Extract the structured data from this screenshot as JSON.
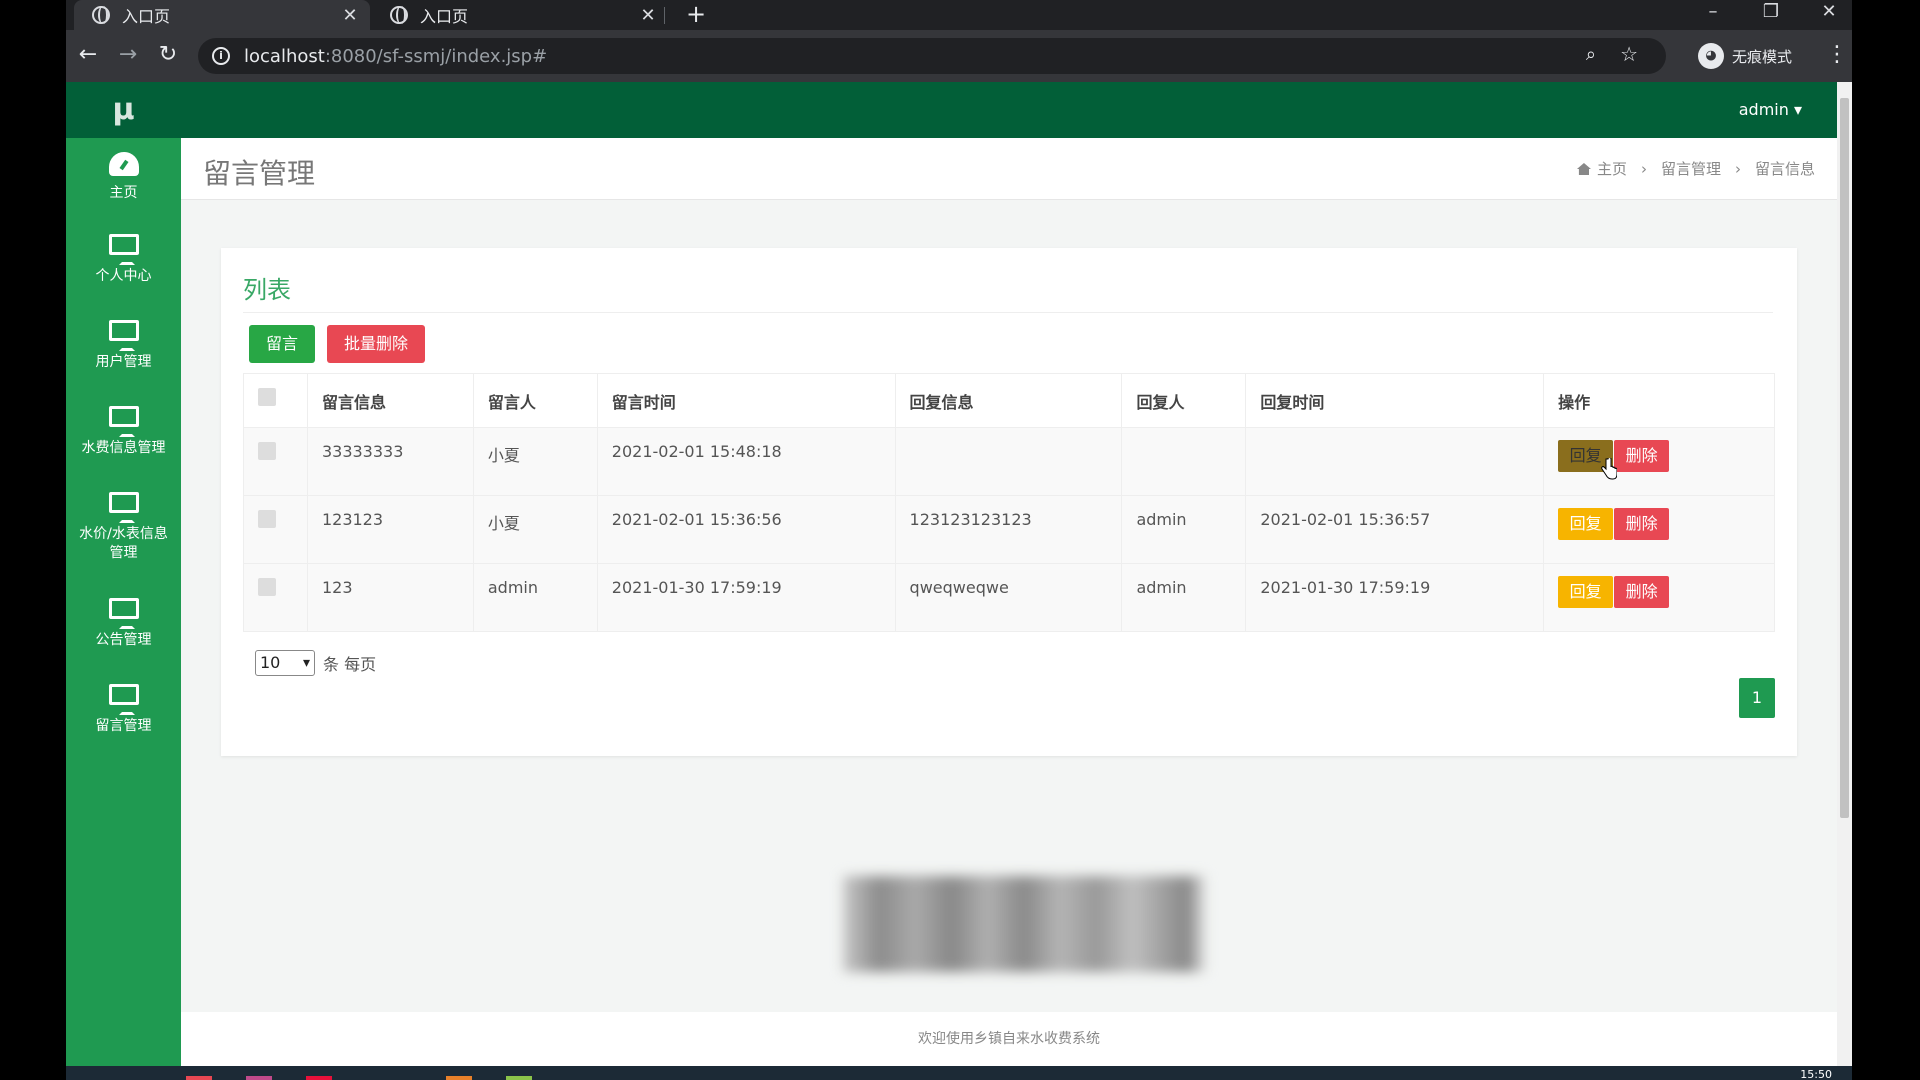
{
  "browser": {
    "tabs": [
      {
        "title": "入口页",
        "active": true
      },
      {
        "title": "入口页",
        "active": false
      }
    ],
    "url_host": "localhost",
    "url_path": ":8080/sf-ssmj/index.jsp#",
    "incognito_label": "无痕模式"
  },
  "app": {
    "logo": "μ",
    "user": "admin ▾",
    "sidebar": [
      {
        "label": "主页",
        "icon": "dashboard-icon"
      },
      {
        "label": "个人中心",
        "icon": "monitor-icon"
      },
      {
        "label": "用户管理",
        "icon": "monitor-icon"
      },
      {
        "label": "水费信息管理",
        "icon": "monitor-icon"
      },
      {
        "label": "水价/水表信息管理",
        "icon": "monitor-icon"
      },
      {
        "label": "公告管理",
        "icon": "monitor-icon"
      },
      {
        "label": "留言管理",
        "icon": "monitor-icon"
      }
    ]
  },
  "page": {
    "title": "留言管理",
    "breadcrumb": [
      "主页",
      "留言管理",
      "留言信息"
    ],
    "card_title": "列表",
    "add_button": "留言",
    "batch_delete_button": "批量删除",
    "columns": [
      "留言信息",
      "留言人",
      "留言时间",
      "回复信息",
      "回复人",
      "回复时间",
      "操作"
    ],
    "rows": [
      {
        "message": "33333333",
        "author": "小夏",
        "time": "2021-02-01 15:48:18",
        "reply": "",
        "replier": "",
        "reply_time": ""
      },
      {
        "message": "123123",
        "author": "小夏",
        "time": "2021-02-01 15:36:56",
        "reply": "123123123123",
        "replier": "admin",
        "reply_time": "2021-02-01 15:36:57"
      },
      {
        "message": "123",
        "author": "admin",
        "time": "2021-01-30 17:59:19",
        "reply": "qweqweqwe",
        "replier": "admin",
        "reply_time": "2021-01-30 17:59:19"
      }
    ],
    "reply_button": "回复",
    "delete_button": "删除",
    "page_size": "10",
    "page_size_suffix": "条 每页",
    "current_page": "1",
    "footer": "欢迎使用乡镇自来水收费系统"
  },
  "taskbar": {
    "clock": "15:50"
  },
  "colors": {
    "sidebar": "#1f9a51",
    "topbar": "#025f38",
    "accent_green": "#28a745",
    "danger": "#e84853",
    "warning": "#f7b400"
  }
}
